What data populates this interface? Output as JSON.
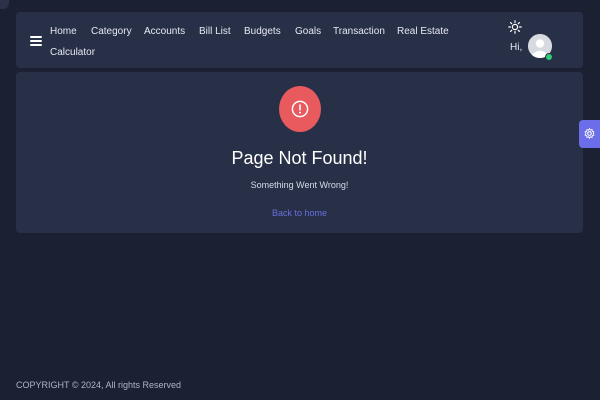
{
  "header": {
    "nav": [
      {
        "label": "Home"
      },
      {
        "label": "Category"
      },
      {
        "label": "Accounts"
      },
      {
        "label": "Bill List"
      },
      {
        "label": "Budgets"
      },
      {
        "label": "Goals"
      },
      {
        "label": "Transaction"
      },
      {
        "label": "Real Estate"
      },
      {
        "label": "Calculator"
      }
    ],
    "greeting": "Hi,",
    "icons": {
      "menu": "hamburger-icon",
      "theme": "sun-icon",
      "user": "avatar"
    }
  },
  "error": {
    "icon": "exclamation-circle-icon",
    "title": "Page Not Found!",
    "message": "Something Went Wrong!",
    "link_label": "Back to home"
  },
  "settings": {
    "icon": "gear-icon"
  },
  "footer": {
    "copyright": "COPYRIGHT © 2024, All rights Reserved"
  },
  "colors": {
    "background": "#1b2033",
    "panel": "#283048",
    "error_red": "#e85a5e",
    "accent": "#6b6ee8",
    "status_online": "#2ecc71"
  }
}
